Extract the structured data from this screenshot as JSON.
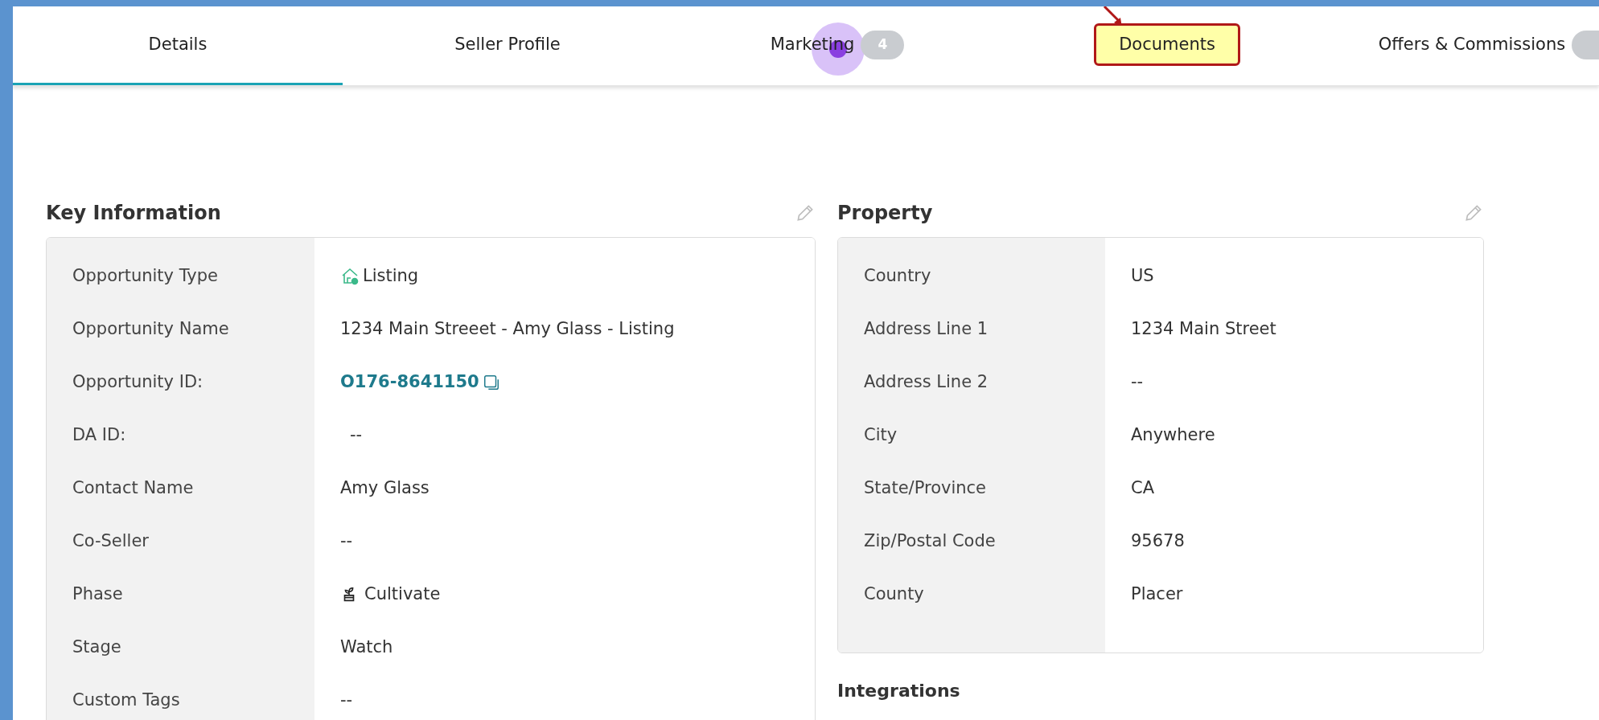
{
  "tabs": [
    {
      "label": "Details",
      "selected": true,
      "highlighted": false
    },
    {
      "label": "Seller Profile",
      "selected": false,
      "highlighted": false
    },
    {
      "label": "Marketing",
      "selected": false,
      "highlighted": false,
      "badge": "4"
    },
    {
      "label": "Documents",
      "selected": false,
      "highlighted": true
    },
    {
      "label": "Offers & Commissions",
      "selected": false,
      "highlighted": false,
      "empty_badge": true
    }
  ],
  "key_information": {
    "title": "Key Information",
    "rows": [
      {
        "label": "Opportunity Type",
        "value": "Listing",
        "kind": "house"
      },
      {
        "label": "Opportunity Name",
        "value": "1234 Main Streeet - Amy Glass - Listing",
        "kind": "text"
      },
      {
        "label": "Opportunity ID:",
        "value": "O176-8641150",
        "kind": "id"
      },
      {
        "label": "DA ID:",
        "value": "--",
        "kind": "indent"
      },
      {
        "label": "Contact Name",
        "value": "Amy Glass",
        "kind": "text"
      },
      {
        "label": "Co-Seller",
        "value": "--",
        "kind": "text"
      },
      {
        "label": "Phase",
        "value": "Cultivate",
        "kind": "plant"
      },
      {
        "label": "Stage",
        "value": "Watch",
        "kind": "text"
      },
      {
        "label": "Custom Tags",
        "value": "--",
        "kind": "text"
      }
    ]
  },
  "property": {
    "title": "Property",
    "rows": [
      {
        "label": "Country",
        "value": "US"
      },
      {
        "label": "Address Line 1",
        "value": "1234 Main Street"
      },
      {
        "label": "Address Line 2",
        "value": "--"
      },
      {
        "label": "City",
        "value": "Anywhere"
      },
      {
        "label": "State/Province",
        "value": "CA"
      },
      {
        "label": "Zip/Postal Code",
        "value": "95678"
      },
      {
        "label": "County",
        "value": "Placer"
      }
    ]
  },
  "integrations": {
    "title": "Integrations"
  }
}
